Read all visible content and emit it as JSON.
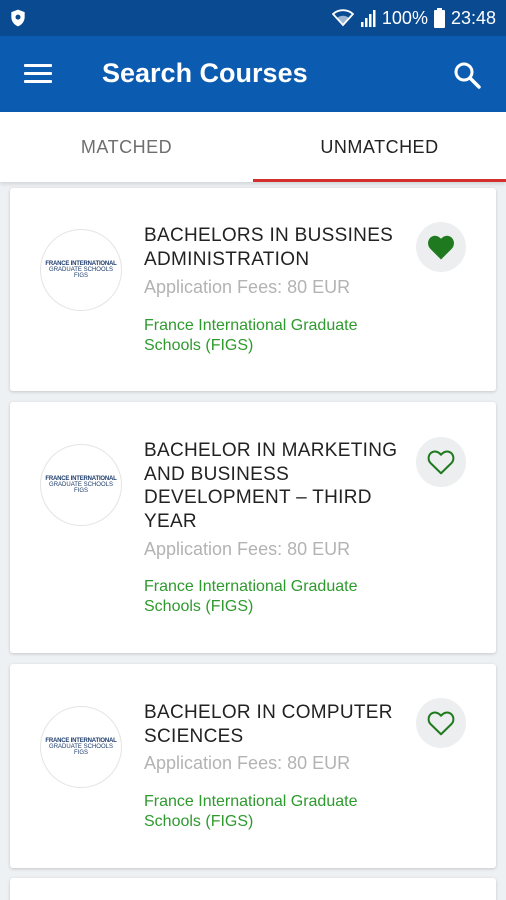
{
  "status_bar": {
    "battery": "100%",
    "time": "23:48"
  },
  "app_bar": {
    "title": "Search Courses"
  },
  "tabs": [
    {
      "label": "MATCHED",
      "active": false
    },
    {
      "label": "UNMATCHED",
      "active": true
    }
  ],
  "courses": [
    {
      "title": "BACHELORS IN BUSSINES ADMINISTRATION",
      "fees": "Application Fees: 80 EUR",
      "school": "France International Graduate Schools (FIGS)",
      "favorite": true,
      "logo": {
        "line1": "FRANCE INTERNATIONAL",
        "line2": "GRADUATE SCHOOLS",
        "line3": "FIGS"
      }
    },
    {
      "title": "BACHELOR IN MARKETING AND BUSINESS DEVELOPMENT – THIRD YEAR",
      "fees": "Application Fees: 80 EUR",
      "school": "France International Graduate Schools (FIGS)",
      "favorite": false,
      "logo": {
        "line1": "FRANCE INTERNATIONAL",
        "line2": "GRADUATE SCHOOLS",
        "line3": "FIGS"
      }
    },
    {
      "title": "BACHELOR IN COMPUTER SCIENCES",
      "fees": "Application Fees: 80 EUR",
      "school": "France International Graduate Schools (FIGS)",
      "favorite": false,
      "logo": {
        "line1": "FRANCE INTERNATIONAL",
        "line2": "GRADUATE SCHOOLS",
        "line3": "FIGS"
      }
    }
  ],
  "colors": {
    "status_bar": "#0a4a91",
    "app_bar": "#0b5bb0",
    "tab_indicator": "#d32f2f",
    "school_text": "#2e9a2e",
    "heart": "#1f7a1f"
  },
  "icons": [
    "shield-icon",
    "wifi-icon",
    "signal-icon",
    "battery-icon",
    "menu-icon",
    "search-icon",
    "heart-filled-icon",
    "heart-outline-icon"
  ]
}
